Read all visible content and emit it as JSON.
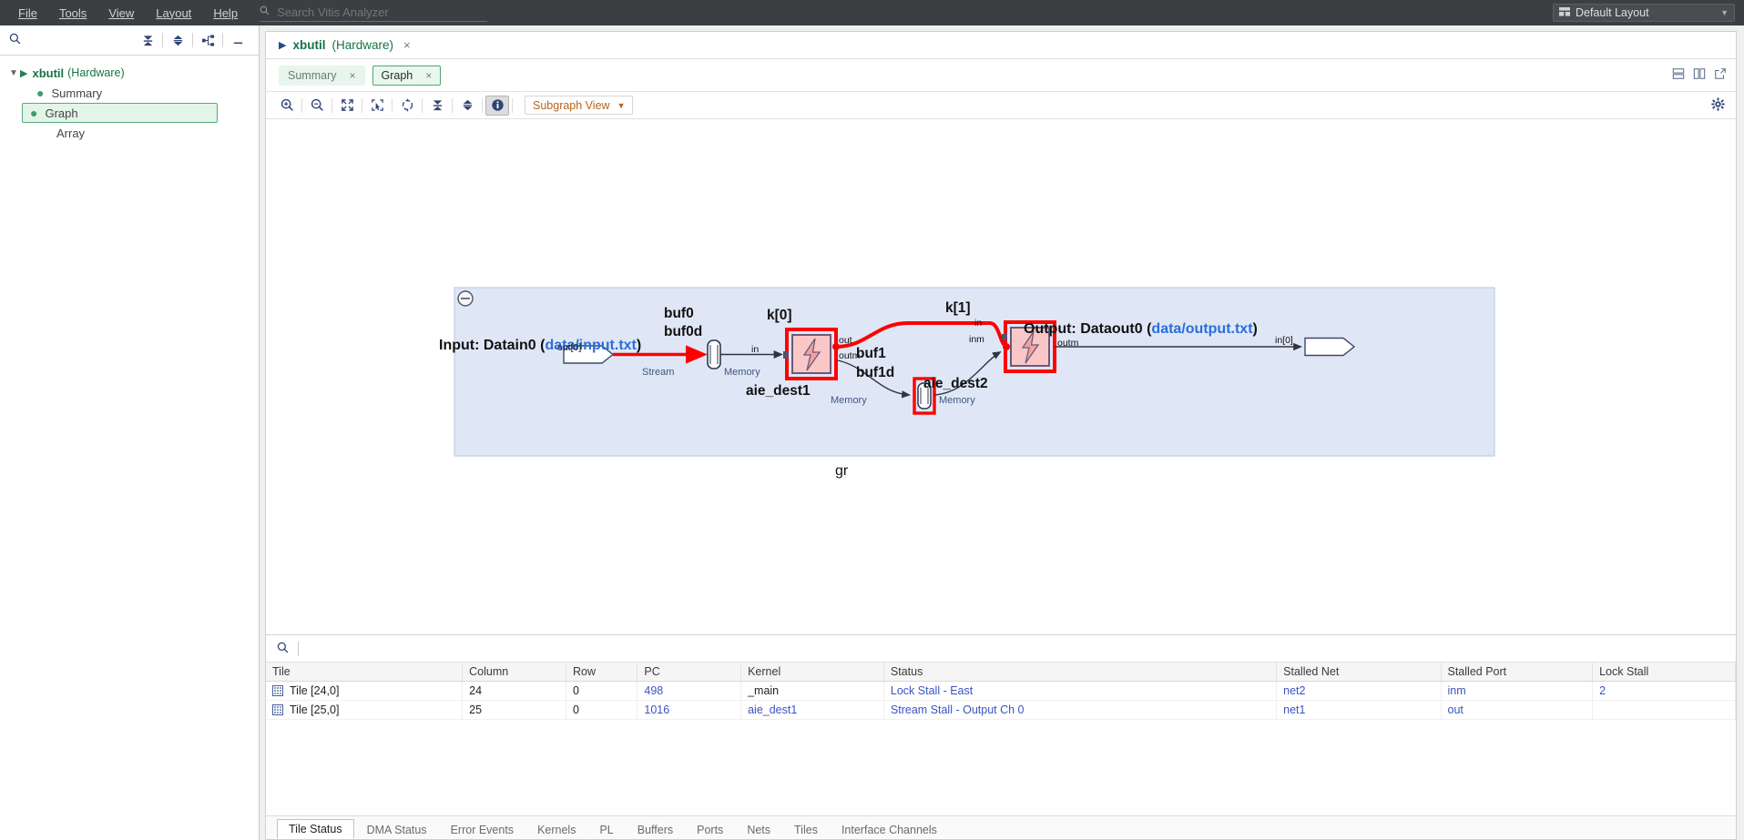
{
  "menubar": {
    "items": [
      {
        "label": "File",
        "accel": "F"
      },
      {
        "label": "Tools",
        "accel": "T"
      },
      {
        "label": "View",
        "accel": "V"
      },
      {
        "label": "Layout",
        "accel": "L"
      },
      {
        "label": "Help",
        "accel": "H"
      }
    ],
    "search_placeholder": "Search Vitis Analyzer",
    "search_value": "",
    "layout_select": "Default Layout"
  },
  "left_panel": {
    "toolbar": [
      {
        "name": "collapse-all-icon",
        "glyph": "⧨"
      },
      {
        "name": "expand-collapse-icon",
        "glyph": "⧩"
      },
      {
        "name": "hierarchy-icon",
        "glyph": "⎇"
      },
      {
        "name": "minimize-icon",
        "glyph": "—"
      }
    ],
    "search_placeholder": "",
    "tree": {
      "root": {
        "label": "xbutil",
        "suffix": "(Hardware)"
      },
      "children": [
        {
          "label": "Summary",
          "bullet": true,
          "selected": false
        },
        {
          "label": "Graph",
          "bullet": true,
          "selected": true
        },
        {
          "label": "Array",
          "bullet": false,
          "selected": false
        }
      ]
    }
  },
  "document": {
    "tab": {
      "title": "xbutil",
      "suffix": "(Hardware)",
      "close": "×"
    },
    "subtabs": [
      {
        "label": "Summary",
        "active": false,
        "close": "×"
      },
      {
        "label": "Graph",
        "active": true,
        "close": "×"
      }
    ],
    "view_buttons": [
      {
        "name": "split-horizontal-icon"
      },
      {
        "name": "split-vertical-icon"
      },
      {
        "name": "popout-icon"
      }
    ]
  },
  "graph_toolbar": {
    "buttons": [
      {
        "name": "zoom-in-icon",
        "active": false
      },
      {
        "name": "zoom-out-icon",
        "active": false
      },
      {
        "name": "fit-to-screen-icon",
        "active": false
      },
      {
        "name": "zoom-to-selection-icon",
        "active": false
      },
      {
        "name": "reset-view-icon",
        "active": false
      },
      {
        "name": "collapse-all-icon",
        "active": false
      },
      {
        "name": "expand-all-icon",
        "active": false
      },
      {
        "name": "info-icon",
        "active": true
      }
    ],
    "view_dropdown": "Subgraph View",
    "settings_icon": "gear-icon"
  },
  "graph": {
    "subgraph_label": "gr",
    "collapse_icon": "⊖",
    "input": {
      "prefix": "Input: Datain0 (",
      "link": "data/input.txt",
      "suffix": ")",
      "port": "out[0]"
    },
    "buf0": {
      "name": "buf0",
      "sub": "buf0d",
      "left_label": "Stream",
      "right_label": "Memory"
    },
    "buf1": {
      "name": "buf1",
      "sub": "buf1d",
      "left_label": "Memory",
      "right_label": "Memory"
    },
    "kernel0": {
      "top": "k[0]",
      "bottom": "aie_dest1",
      "ports_in": [
        "in"
      ],
      "ports_out": [
        "out",
        "outm"
      ]
    },
    "kernel1": {
      "top": "k[1]",
      "bottom": "aie_dest2",
      "ports_in": [
        "in",
        "inm"
      ],
      "ports_out": [
        "outm"
      ]
    },
    "output": {
      "prefix": "Output: Dataout0 (",
      "link": "data/output.txt",
      "suffix": ")",
      "port": "in[0]"
    }
  },
  "table": {
    "search_value": "",
    "search_placeholder": "",
    "columns": [
      "Tile",
      "Column",
      "Row",
      "PC",
      "Kernel",
      "Status",
      "Stalled Net",
      "Stalled Port",
      "Lock Stall"
    ],
    "rows": [
      {
        "tile": "Tile [24,0]",
        "column": "24",
        "row": "0",
        "pc": "498",
        "kernel": "_main",
        "status": "Lock Stall - East",
        "stalled_net": "net2",
        "stalled_port": "inm",
        "lock_stall": "2"
      },
      {
        "tile": "Tile [25,0]",
        "column": "25",
        "row": "0",
        "pc": "1016",
        "kernel": "aie_dest1",
        "status": "Stream Stall - Output Ch 0",
        "stalled_net": "net1",
        "stalled_port": "out",
        "lock_stall": ""
      }
    ]
  },
  "bottom_tabs": [
    {
      "label": "Tile Status",
      "active": true
    },
    {
      "label": "DMA Status",
      "active": false
    },
    {
      "label": "Error Events",
      "active": false
    },
    {
      "label": "Kernels",
      "active": false
    },
    {
      "label": "PL",
      "active": false
    },
    {
      "label": "Buffers",
      "active": false
    },
    {
      "label": "Ports",
      "active": false
    },
    {
      "label": "Nets",
      "active": false
    },
    {
      "label": "Tiles",
      "active": false
    },
    {
      "label": "Interface Channels",
      "active": false
    }
  ],
  "colors": {
    "accent_green": "#177245",
    "link_blue": "#2a6ed8",
    "highlight_red": "#ff0000",
    "menu_bg": "#3c3f41",
    "table_blue": "#3b53c4"
  }
}
